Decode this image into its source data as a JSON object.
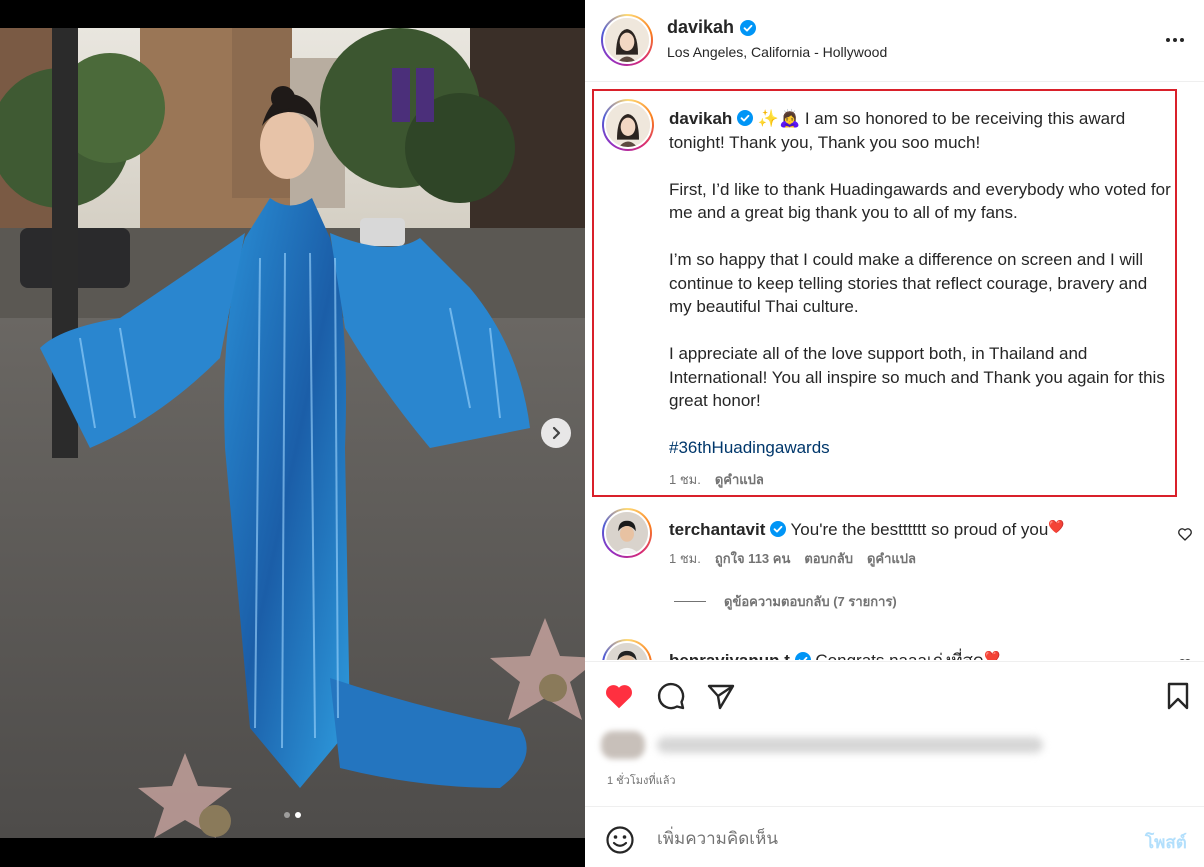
{
  "header": {
    "username": "davikah",
    "location": "Los Angeles, California - Hollywood",
    "more_icon": "more-horizontal-icon"
  },
  "caption": {
    "username": "davikah",
    "emojis": "✨🙇‍♀️",
    "paragraphs": [
      "I am so honored to be receiving this award tonight! Thank you, Thank you soo much!",
      "First, I’d like to thank Huadingawards and everybody who voted for me and a great big thank you to all of my fans.",
      "I’m so happy that I could make a difference on screen and I will continue to keep telling stories that reflect courage, bravery and my beautiful Thai culture.",
      "I appreciate all of the love support both, in Thailand and International! You all inspire so much and Thank you again for this great honor!"
    ],
    "hashtag": "#36thHuadingawards",
    "time": "1 ชม.",
    "translate": "ดูคำแปล",
    "highlight_color": "#d9202a"
  },
  "comments": [
    {
      "username": "terchantavit",
      "text": "You're the bestttttt so proud of you",
      "emoji": "❤️",
      "time": "1 ชม.",
      "likes": "ถูกใจ 113 คน",
      "reply": "ตอบกลับ",
      "translate": "ดูคำแปล"
    },
    {
      "username": "benraviyanun.t",
      "text": "Congrats naaaเก่งที่สุด",
      "emoji": "❤️"
    }
  ],
  "view_replies": "ดูข้อความตอบกลับ (7 รายการ)",
  "actions": {
    "like_icon": "heart-filled-icon",
    "comment_icon": "comment-icon",
    "share_icon": "share-icon",
    "save_icon": "bookmark-icon",
    "like_color": "#ff3040"
  },
  "post_time": "1 ชั่วโมงที่แล้ว",
  "comment_bar": {
    "placeholder": "เพิ่มความคิดเห็น",
    "post_label": "โพสต์"
  },
  "media": {
    "slides": 2,
    "active_slide": 2
  }
}
